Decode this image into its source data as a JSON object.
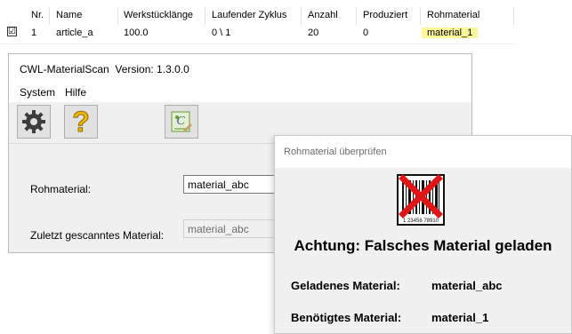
{
  "grid": {
    "headers": [
      "Nr.",
      "Name",
      "Werkstücklänge",
      "Laufender Zyklus",
      "Anzahl",
      "Produziert",
      "Rohmaterial"
    ],
    "row": {
      "checked_mark": "☑",
      "nr": "1",
      "name": "article_a",
      "length": "100.0",
      "cycle": "0 \\ 1",
      "count": "20",
      "produced": "0",
      "material": "material_1"
    },
    "highlight_color": "#fbf79a"
  },
  "window": {
    "title": "CWL-MaterialScan  Version: 1.3.0.0",
    "menu": [
      "System",
      "Hilfe"
    ],
    "toolbar_icons": [
      "gear-icon",
      "help-icon",
      "material-icon"
    ],
    "fields": {
      "raw_label": "Rohmaterial:",
      "raw_value": "material_abc",
      "last_label": "Zuletzt gescanntes Material:",
      "last_value": "material_abc"
    }
  },
  "dialog": {
    "title": "Rohmaterial überprüfen",
    "barcode_text": "1 23456 78910",
    "warning": "Achtung: Falsches Material geladen",
    "loaded_label": "Geladenes Material:",
    "loaded_value": "material_abc",
    "required_label": "Benötigtes Material:",
    "required_value": "material_1",
    "error_color": "#e01515"
  }
}
